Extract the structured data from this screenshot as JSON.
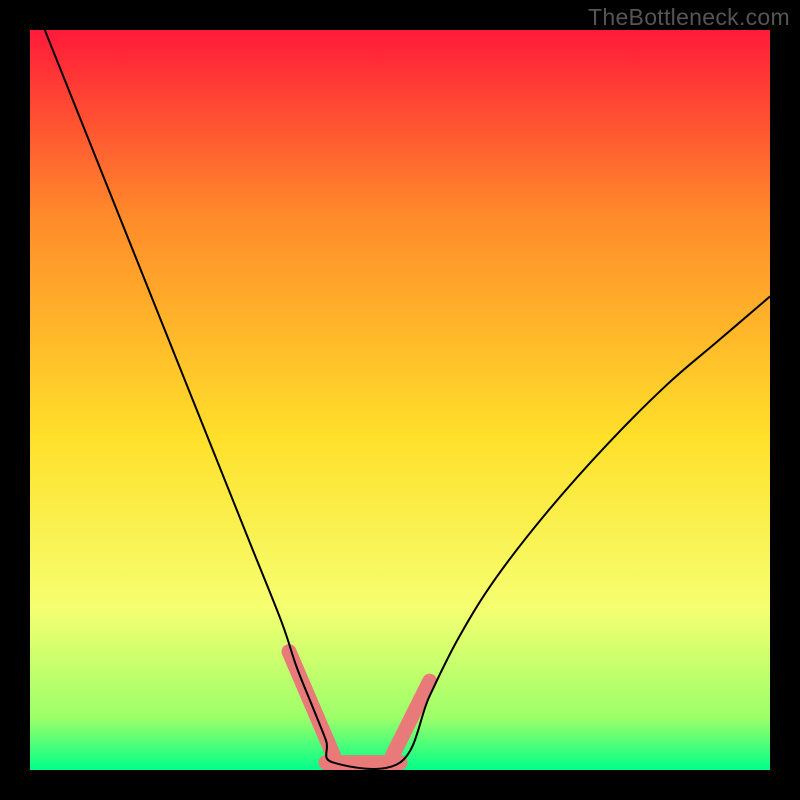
{
  "watermark": "TheBottleneck.com",
  "chart_data": {
    "type": "line",
    "title": "",
    "xlabel": "",
    "ylabel": "",
    "xlim": [
      0,
      100
    ],
    "ylim": [
      0,
      100
    ],
    "grid": false,
    "legend": false,
    "series": [
      {
        "name": "curve-left",
        "x": [
          2,
          6,
          10,
          14,
          18,
          22,
          26,
          30,
          34,
          36,
          38,
          40,
          41
        ],
        "y": [
          100,
          90,
          80,
          70,
          60,
          50,
          40,
          30,
          20,
          14,
          9,
          4,
          1
        ]
      },
      {
        "name": "floor",
        "x": [
          41,
          50
        ],
        "y": [
          1,
          1
        ]
      },
      {
        "name": "curve-right",
        "x": [
          50,
          54,
          58,
          63,
          70,
          78,
          86,
          93,
          100
        ],
        "y": [
          1,
          10,
          18,
          26,
          35,
          44,
          52,
          58,
          64
        ]
      }
    ],
    "highlights": [
      {
        "name": "highlight-left",
        "x": [
          35,
          41
        ],
        "y": [
          16,
          2
        ]
      },
      {
        "name": "highlight-floor",
        "x": [
          40,
          50
        ],
        "y": [
          1,
          1
        ]
      },
      {
        "name": "highlight-right",
        "x": [
          49,
          54
        ],
        "y": [
          2,
          12
        ]
      }
    ],
    "background_gradient": {
      "top": "#ff1a3a",
      "upper_mid": "#ff8a2a",
      "mid": "#ffe02a",
      "lower_mid": "#f6ff70",
      "near_bottom": "#9cff6a",
      "bottom": "#00ff88"
    },
    "highlight_color": "#e87a7a",
    "curve_color": "#000000"
  }
}
